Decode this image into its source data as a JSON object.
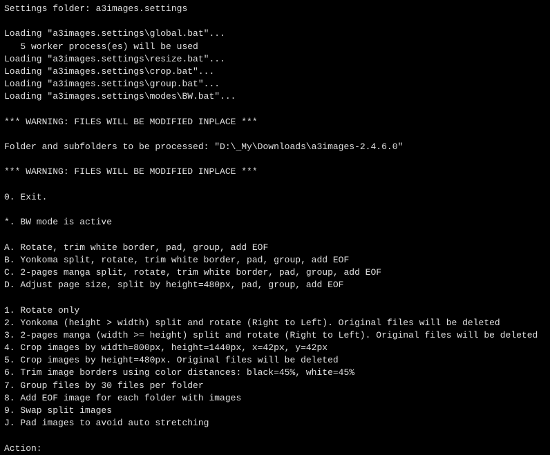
{
  "header": {
    "settings_folder": "Settings folder: a3images.settings"
  },
  "loading": {
    "l1": "Loading \"a3images.settings\\global.bat\"...",
    "l2": "   5 worker process(es) will be used",
    "l3": "Loading \"a3images.settings\\resize.bat\"...",
    "l4": "Loading \"a3images.settings\\crop.bat\"...",
    "l5": "Loading \"a3images.settings\\group.bat\"...",
    "l6": "Loading \"a3images.settings\\modes\\BW.bat\"..."
  },
  "warning1": "*** WARNING: FILES WILL BE MODIFIED INPLACE ***",
  "folder_line": "Folder and subfolders to be processed: \"D:\\_My\\Downloads\\a3images-2.4.6.0\"",
  "warning2": "*** WARNING: FILES WILL BE MODIFIED INPLACE ***",
  "menu": {
    "exit": "0. Exit.",
    "mode": "*. BW mode is active",
    "A": "A. Rotate, trim white border, pad, group, add EOF",
    "B": "B. Yonkoma split, rotate, trim white border, pad, group, add EOF",
    "C": "C. 2-pages manga split, rotate, trim white border, pad, group, add EOF",
    "D": "D. Adjust page size, split by height=480px, pad, group, add EOF",
    "n1": "1. Rotate only",
    "n2": "2. Yonkoma (height > width) split and rotate (Right to Left). Original files will be deleted",
    "n3": "3. 2-pages manga (width >= height) split and rotate (Right to Left). Original files will be deleted",
    "n4": "4. Crop images by width=800px, height=1440px, x=42px, y=42px",
    "n5": "5. Crop images by height=480px. Original files will be deleted",
    "n6": "6. Trim image borders using color distances: black=45%, white=45%",
    "n7": "7. Group files by 30 files per folder",
    "n8": "8. Add EOF image for each folder with images",
    "n9": "9. Swap split images",
    "nJ": "J. Pad images to avoid auto stretching"
  },
  "prompt": {
    "label": "Action:"
  }
}
